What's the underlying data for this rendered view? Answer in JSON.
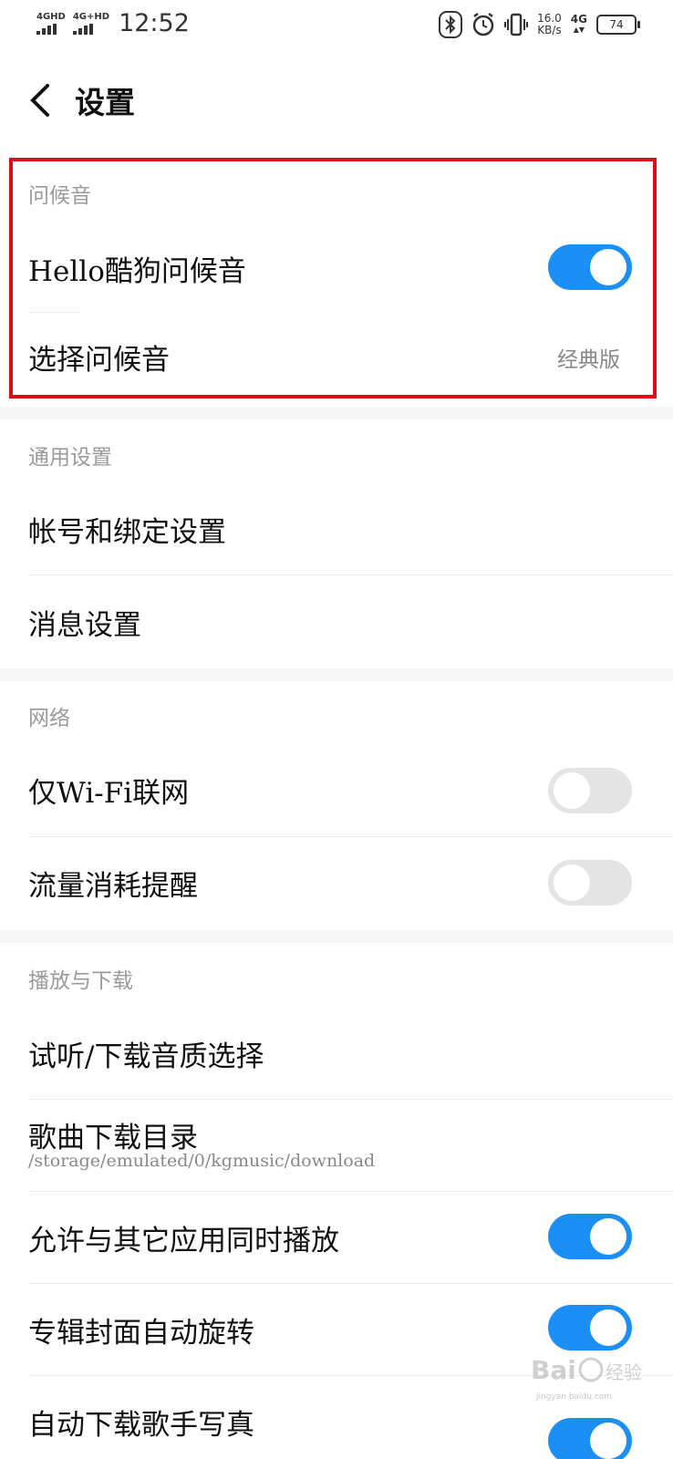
{
  "status_bar": {
    "sim1": "4GHD",
    "sim2": "4G+HD",
    "time": "12:52",
    "speed_value": "16.0",
    "speed_unit": "KB/s",
    "network": "4G",
    "battery": "74",
    "icons": [
      "bluetooth-icon",
      "alarm-icon",
      "vibrate-icon"
    ]
  },
  "header": {
    "title": "设置",
    "back_icon": "chevron-left-icon"
  },
  "sections": {
    "greeting": {
      "title": "问候音",
      "rows": {
        "hello": {
          "label": "Hello酷狗问候音",
          "toggle_on": true
        },
        "choose": {
          "label": "选择问候音",
          "value": "经典版"
        }
      }
    },
    "general": {
      "title": "通用设置",
      "rows": {
        "account": {
          "label": "帐号和绑定设置"
        },
        "message": {
          "label": "消息设置"
        }
      }
    },
    "network": {
      "title": "网络",
      "rows": {
        "wifi_only": {
          "label": "仅Wi-Fi联网",
          "toggle_on": false
        },
        "data_alert": {
          "label": "流量消耗提醒",
          "toggle_on": false
        }
      }
    },
    "playback": {
      "title": "播放与下载",
      "rows": {
        "quality": {
          "label": "试听/下载音质选择"
        },
        "directory": {
          "label": "歌曲下载目录",
          "sub": "/storage/emulated/0/kgmusic/download"
        },
        "concurrent": {
          "label": "允许与其它应用同时播放",
          "toggle_on": true
        },
        "rotate_cover": {
          "label": "专辑封面自动旋转",
          "toggle_on": true
        },
        "auto_photo": {
          "label": "自动下载歌手写真",
          "toggle_on": true
        }
      }
    }
  },
  "colors": {
    "accent": "#1b8ff5",
    "highlight": "#e00b16",
    "toggle_off": "#e4e4e4"
  },
  "watermark": {
    "brand": "Bai",
    "brand2": "经验",
    "domain": "jingyan.baidu.com"
  }
}
